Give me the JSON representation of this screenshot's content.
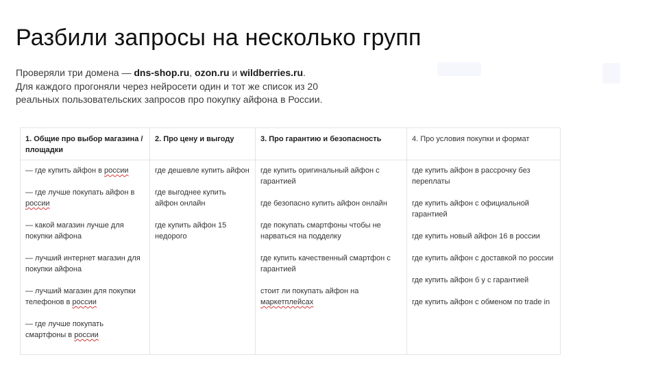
{
  "title": "Разбили запросы на несколько групп",
  "intro": {
    "line1_prefix": "Проверяли три домена — ",
    "domains": [
      "dns-shop.ru",
      "ozon.ru",
      "wildberries.ru"
    ],
    "sep1": ", ",
    "sep2": " и ",
    "end": ".",
    "line2": "Для каждого прогоняли через нейросети один и тот же список из 20",
    "line3": "реальных пользовательских запросов про покупку айфона в России."
  },
  "table": {
    "columns": [
      {
        "header": "1. Общие про выбор магазина / площадки",
        "items": [
          [
            "— где купить айфон в ",
            {
              "t": "россии",
              "sp": true
            }
          ],
          [
            "— где лучше покупать айфон в ",
            {
              "t": "россии",
              "sp": true
            }
          ],
          [
            "— какой магазин лучше для покупки айфона"
          ],
          [
            "— лучший интернет магазин для покупки айфона"
          ],
          [
            "— лучший магазин для покупки телефонов в ",
            {
              "t": "россии",
              "sp": true
            }
          ],
          [
            "— где лучше покупать смартфоны в ",
            {
              "t": "россии",
              "sp": true
            }
          ]
        ]
      },
      {
        "header": "2. Про цену и выгоду",
        "items": [
          [
            "где дешевле купить айфон"
          ],
          [
            "где выгоднее купить айфон онлайн"
          ],
          [
            "где купить айфон 15 недорого"
          ]
        ]
      },
      {
        "header": "3. Про гарантию и безопасность",
        "items": [
          [
            "где купить оригинальный айфон с гарантией"
          ],
          [
            "где безопасно купить айфон онлайн"
          ],
          [
            "где покупать смартфоны чтобы не нарваться на подделку"
          ],
          [
            "где купить качественный смартфон с гарантией"
          ],
          [
            "стоит ли покупать айфон на ",
            {
              "t": "маркетплейсах",
              "sp": true
            }
          ]
        ]
      },
      {
        "header": "4. Про условия покупки и формат",
        "header_bold": false,
        "items": [
          [
            "где купить айфон в рассрочку без переплаты"
          ],
          [
            "где купить айфон с официальной гарантией"
          ],
          [
            "где купить новый айфон 16 в россии"
          ],
          [
            "где купить айфон с доставкой по россии"
          ],
          [
            "где купить айфон б у с гарантией"
          ],
          [
            "где купить айфон с обменом по trade in"
          ]
        ]
      }
    ]
  },
  "colors": {
    "text": "#333333",
    "title": "#111111",
    "border": "#e4e4e4",
    "spell_underline": "#d23a3a"
  }
}
